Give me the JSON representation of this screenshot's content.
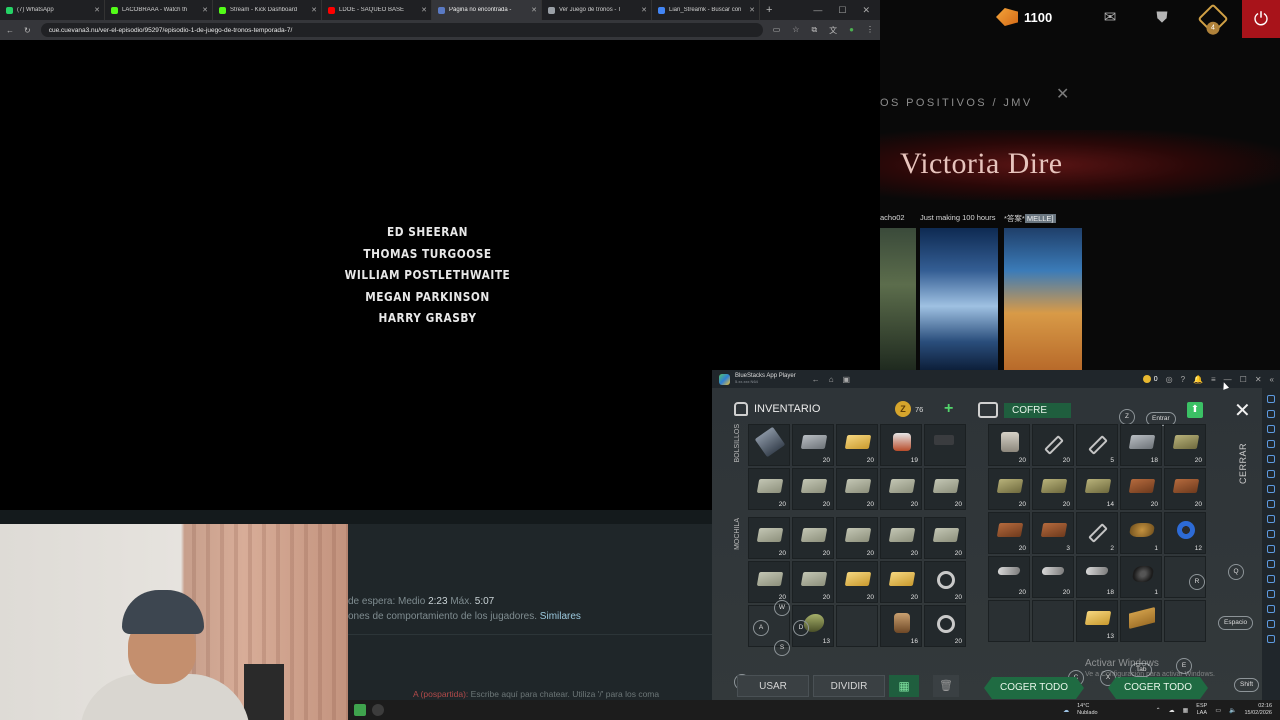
{
  "browser": {
    "tabs": [
      {
        "title": "(7) WhatsApp",
        "color": "#25d366"
      },
      {
        "title": "LACOBRAAA - Watch th",
        "color": "#53fc18"
      },
      {
        "title": "Stream - Kick Dashboard",
        "color": "#53fc18"
      },
      {
        "title": "LDOE - SAQUEO BASE",
        "color": "#ff0000"
      },
      {
        "title": "Página no encontrada -",
        "color": "#5a7ac4"
      },
      {
        "title": "Ver Juego de tronos - T",
        "color": "#9aa0a6"
      },
      {
        "title": "Lian_Streamk - Buscar con",
        "color": "#4285f4"
      }
    ],
    "url": "cue.cuevana3.nu/ver-el-episodio/95297/episodio-1-de-juego-de-tronos-temporada-7/",
    "credits": [
      "ED SHEERAN",
      "THOMAS TURGOOSE",
      "WILLIAM POSTLETHWAITE",
      "MEGAN PARKINSON",
      "HARRY GRASBY"
    ]
  },
  "page_lower": {
    "stats_prefix": "de espera: Medio",
    "stats_avg": "2:23",
    "stats_max_label": "Máx.",
    "stats_max": "5:07",
    "behavior_text": "ones de comportamiento de los jugadores.",
    "behavior_link": "Similares",
    "chat_name": "A (pospartida):",
    "chat_placeholder": "Escribe aquí para chatear. Utiliza '/' para los coma"
  },
  "dota": {
    "shards": "1100",
    "pack_badge": "4",
    "subtitle": "OS POSITIVOS / JMV",
    "title": "Victoria Dire",
    "players": [
      {
        "name": "acho02"
      },
      {
        "name": "Just making 100 hours"
      },
      {
        "name": "*答案*",
        "tag": "MELLE]"
      }
    ]
  },
  "bluestacks": {
    "app_name": "BlueStacks App Player",
    "app_sub": "5.xx.xxx  N64",
    "coins": "0",
    "inventory_label": "INVENTARIO",
    "coins_game": "76",
    "pockets_label": "BOLSILLOS",
    "backpack_label": "MOCHILA",
    "chest_label": "COFRE",
    "close_label": "CERRAR",
    "enter_label": "Entrar",
    "use_label": "USAR",
    "split_label": "DIVIDIR",
    "take_all_label": "COGER TODO",
    "take_all_right_label": "COGER TODO",
    "space_label": "Espacio",
    "shift_label": "Shift",
    "tab_label": "Tab",
    "hints": {
      "z": "Z",
      "q": "Q",
      "r": "R",
      "w": "W",
      "a": "A",
      "d": "D",
      "s": "S",
      "f": "F",
      "c": "C",
      "x": "X",
      "e": "E"
    },
    "pockets": [
      {
        "icon": "hammer",
        "qty": ""
      },
      {
        "icon": "iron",
        "qty": "20"
      },
      {
        "icon": "gold",
        "qty": "20"
      },
      {
        "icon": "jar",
        "qty": "19"
      },
      {
        "icon": "gun",
        "qty": ""
      },
      {
        "icon": "stone",
        "qty": "20"
      },
      {
        "icon": "stone",
        "qty": "20"
      },
      {
        "icon": "stone",
        "qty": "20"
      },
      {
        "icon": "stone",
        "qty": "20"
      },
      {
        "icon": "stone",
        "qty": "20"
      }
    ],
    "backpack": [
      {
        "icon": "stone",
        "qty": "20"
      },
      {
        "icon": "stone",
        "qty": "20"
      },
      {
        "icon": "stone",
        "qty": "20"
      },
      {
        "icon": "stone",
        "qty": "20"
      },
      {
        "icon": "stone",
        "qty": "20"
      },
      {
        "icon": "stone",
        "qty": "20"
      },
      {
        "icon": "stone",
        "qty": "20"
      },
      {
        "icon": "gold",
        "qty": "20"
      },
      {
        "icon": "gold",
        "qty": "20"
      },
      {
        "icon": "ring",
        "qty": "20"
      },
      {
        "icon": "",
        "qty": ""
      },
      {
        "icon": "cans",
        "qty": "13"
      },
      {
        "icon": "",
        "qty": ""
      },
      {
        "icon": "barrel",
        "qty": "16"
      },
      {
        "icon": "ring",
        "qty": "20"
      }
    ],
    "chest": [
      {
        "icon": "pot",
        "qty": "20"
      },
      {
        "icon": "tool",
        "qty": "20"
      },
      {
        "icon": "tool",
        "qty": "5"
      },
      {
        "icon": "iron",
        "qty": "18"
      },
      {
        "icon": "plank",
        "qty": "20"
      },
      {
        "icon": "plank",
        "qty": "20"
      },
      {
        "icon": "plank",
        "qty": "20"
      },
      {
        "icon": "plank",
        "qty": "14"
      },
      {
        "icon": "leather",
        "qty": "20"
      },
      {
        "icon": "leather",
        "qty": "20"
      },
      {
        "icon": "leather",
        "qty": "20"
      },
      {
        "icon": "leather",
        "qty": "3"
      },
      {
        "icon": "tool",
        "qty": "2"
      },
      {
        "icon": "rope",
        "qty": "1"
      },
      {
        "icon": "tape",
        "qty": "12"
      },
      {
        "icon": "bolt",
        "qty": "20"
      },
      {
        "icon": "bolt",
        "qty": "20"
      },
      {
        "icon": "bolt",
        "qty": "18"
      },
      {
        "icon": "coal",
        "qty": "1"
      },
      {
        "icon": "",
        "qty": ""
      },
      {
        "icon": "",
        "qty": ""
      },
      {
        "icon": "",
        "qty": ""
      },
      {
        "icon": "gold",
        "qty": "13"
      },
      {
        "icon": "frame",
        "qty": ""
      },
      {
        "icon": "",
        "qty": ""
      }
    ],
    "watermark_title": "Activar Windows",
    "watermark_sub": "Ve a Configuración para activar Windows."
  },
  "taskbar": {
    "weather_temp": "14°C",
    "weather_desc": "Nublado",
    "lang_top": "ESP",
    "lang_bottom": "LAA",
    "time": "02:16",
    "date": "15/02/2026"
  },
  "colors": {
    "accent_green": "#1f6b42",
    "dota_red": "#a8131a",
    "zcoin": "#d6a52c"
  }
}
